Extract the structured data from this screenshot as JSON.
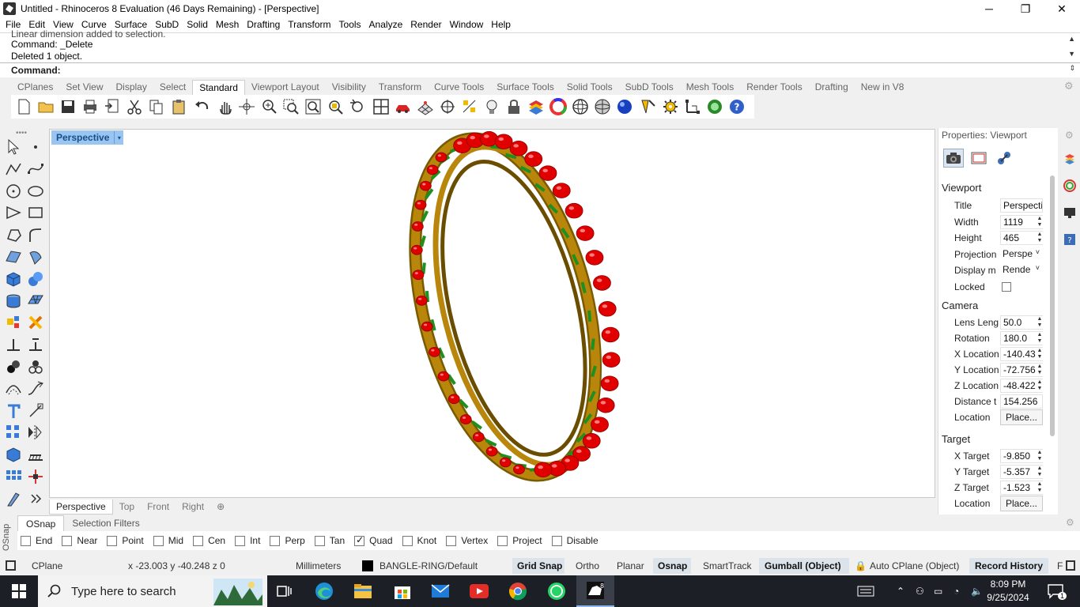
{
  "window": {
    "title": "Untitled - Rhinoceros 8 Evaluation (46 Days Remaining) - [Perspective]",
    "controls": [
      "─",
      "❐",
      "✕"
    ]
  },
  "menu": [
    "File",
    "Edit",
    "View",
    "Curve",
    "Surface",
    "SubD",
    "Solid",
    "Mesh",
    "Drafting",
    "Transform",
    "Tools",
    "Analyze",
    "Render",
    "Window",
    "Help"
  ],
  "command": {
    "history": [
      "Linear dimension added to selection.",
      "Command: _Delete",
      "Deleted 1 object."
    ],
    "prompt": "Command:"
  },
  "toolbar_tabs": [
    "CPlanes",
    "Set View",
    "Display",
    "Select",
    "Standard",
    "Viewport Layout",
    "Visibility",
    "Transform",
    "Curve Tools",
    "Surface Tools",
    "Solid Tools",
    "SubD Tools",
    "Mesh Tools",
    "Render Tools",
    "Drafting",
    "New in V8"
  ],
  "toolbar_tabs_active": "Standard",
  "toolbar_icons": [
    "new-file-icon",
    "open-file-icon",
    "save-icon",
    "print-icon",
    "import-icon",
    "cut-icon",
    "copy-icon",
    "paste-icon",
    "undo-icon",
    "pan-icon",
    "rotate-view-icon",
    "zoom-dynamic-icon",
    "zoom-window-icon",
    "zoom-extents-icon",
    "zoom-selected-icon",
    "undo-view-icon",
    "four-viewports-icon",
    "car-icon",
    "grid-icon",
    "osnap-icon",
    "select-points-icon",
    "light-icon",
    "lock-icon",
    "layer-icon",
    "color-wheel-icon",
    "wireframe-sphere-icon",
    "shaded-sphere-icon",
    "rendered-sphere-icon",
    "options-icon",
    "gear-icon",
    "gumball-icon",
    "render-icon",
    "help-icon"
  ],
  "left_tools": [
    "select-arrow-icon",
    "point-icon",
    "polyline-icon",
    "curve-icon",
    "circle-icon",
    "ellipse-icon",
    "polygon-icon",
    "rectangle-icon",
    "arc-icon",
    "fillet-curve-icon",
    "surface-icon",
    "sweep-icon",
    "box-icon",
    "sphere-icon",
    "cylinder-icon",
    "mesh-icon",
    "explode-icon",
    "boolean-icon",
    "trim-icon",
    "split-icon",
    "group-icon",
    "block-icon",
    "offset-icon",
    "blend-icon",
    "text-icon",
    "dimension-icon",
    "array-icon",
    "mirror-icon",
    "render-object-icon",
    "hatch-icon",
    "grid-array-icon",
    "move-icon",
    "misc-tool-icon",
    "expand-icon"
  ],
  "viewport": {
    "title": "Perspective",
    "dropdown": "▾",
    "tabs": [
      "Perspective",
      "Top",
      "Front",
      "Right"
    ],
    "tabs_active": "Perspective",
    "add_tab": "⊕",
    "model_colors": {
      "gold": "#b8860b",
      "gems": "#e00000",
      "prongs": "#1f8f1f"
    }
  },
  "properties": {
    "header": "Properties: Viewport",
    "section_viewport": "Viewport",
    "fields": [
      {
        "label": "Title",
        "value": "Perspecti",
        "kind": "text"
      },
      {
        "label": "Width",
        "value": "1119",
        "kind": "spin"
      },
      {
        "label": "Height",
        "value": "465",
        "kind": "spin"
      },
      {
        "label": "Projection",
        "value": "Perspe",
        "kind": "select"
      },
      {
        "label": "Display m",
        "value": "Rende",
        "kind": "select"
      },
      {
        "label": "Locked",
        "value": "",
        "kind": "check"
      }
    ],
    "section_camera": "Camera",
    "camera": [
      {
        "label": "Lens Leng",
        "value": "50.0",
        "kind": "spin"
      },
      {
        "label": "Rotation",
        "value": "180.0",
        "kind": "spin"
      },
      {
        "label": "X Location",
        "value": "-140.43",
        "kind": "spin"
      },
      {
        "label": "Y Location",
        "value": "-72.756",
        "kind": "spin"
      },
      {
        "label": "Z Location",
        "value": "-48.422",
        "kind": "spin"
      },
      {
        "label": "Distance t",
        "value": "154.256",
        "kind": "text"
      },
      {
        "label": "Location",
        "value": "Place...",
        "kind": "button"
      }
    ],
    "section_target": "Target",
    "target": [
      {
        "label": "X Target",
        "value": "-9.850",
        "kind": "spin"
      },
      {
        "label": "Y Target",
        "value": "-5.357",
        "kind": "spin"
      },
      {
        "label": "Z Target",
        "value": "-1.523",
        "kind": "spin"
      },
      {
        "label": "Location",
        "value": "Place...",
        "kind": "button"
      }
    ]
  },
  "osnap": {
    "tabs": [
      "OSnap",
      "Selection Filters"
    ],
    "side_label": "OSnap",
    "items": [
      {
        "label": "End",
        "checked": false
      },
      {
        "label": "Near",
        "checked": false
      },
      {
        "label": "Point",
        "checked": false
      },
      {
        "label": "Mid",
        "checked": false
      },
      {
        "label": "Cen",
        "checked": false
      },
      {
        "label": "Int",
        "checked": false
      },
      {
        "label": "Perp",
        "checked": false
      },
      {
        "label": "Tan",
        "checked": false
      },
      {
        "label": "Quad",
        "checked": true
      },
      {
        "label": "Knot",
        "checked": false
      },
      {
        "label": "Vertex",
        "checked": false
      },
      {
        "label": "Project",
        "checked": false
      },
      {
        "label": "Disable",
        "checked": false
      }
    ]
  },
  "status": {
    "cplane": "CPlane",
    "coords": "x -23.003   y -40.248   z 0",
    "units": "Millimeters",
    "layer": "BANGLE-RING/Default",
    "grid_snap": "Grid Snap",
    "ortho": "Ortho",
    "planar": "Planar",
    "osnap": "Osnap",
    "smarttrack": "SmartTrack",
    "gumball": "Gumball (Object)",
    "autocplane": "Auto CPlane (Object)",
    "record_history": "Record History",
    "filter": "F"
  },
  "taskbar": {
    "search_placeholder": "Type here to search",
    "time": "8:09 PM",
    "date": "9/25/2024",
    "notifications": "1"
  }
}
